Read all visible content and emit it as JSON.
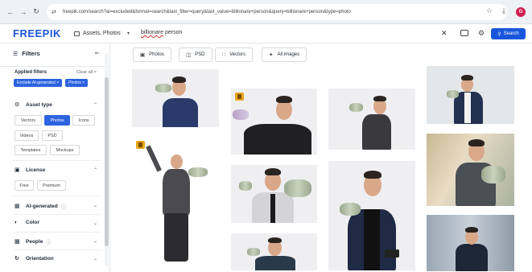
{
  "browser": {
    "url": "freepik.com/search?ai=excluded&format=search&last_filter=query&last_value=billionare+person&query=billionare+person&type=photo",
    "profile_initial": "G"
  },
  "header": {
    "logo": "FREEPIK",
    "scope_label": "Assets, Photos",
    "query_misspelled": "billionare",
    "query_rest": " person",
    "search_label": "Search"
  },
  "sidebar": {
    "title": "Filters",
    "applied_label": "Applied filters",
    "clear_all": "Clear all",
    "chips": [
      "Exclude AI-generated ×",
      "Photos ×"
    ],
    "asset_type": {
      "title": "Asset type",
      "options": [
        "Vectors",
        "Photos",
        "Icons",
        "Videos",
        "PSD",
        "Templates",
        "Mockups"
      ],
      "selected": "Photos"
    },
    "license": {
      "title": "License",
      "options": [
        "Free",
        "Premium"
      ]
    },
    "ai_generated": {
      "title": "AI-generated"
    },
    "color": {
      "title": "Color"
    },
    "people": {
      "title": "People"
    },
    "orientation": {
      "title": "Orientation"
    }
  },
  "tabs": [
    "Photos",
    "PSD",
    "Vectors",
    "All images"
  ],
  "colors": {
    "accent": "#1a56db",
    "chip": "#2b63e0",
    "premium_badge": "#e8a517"
  }
}
